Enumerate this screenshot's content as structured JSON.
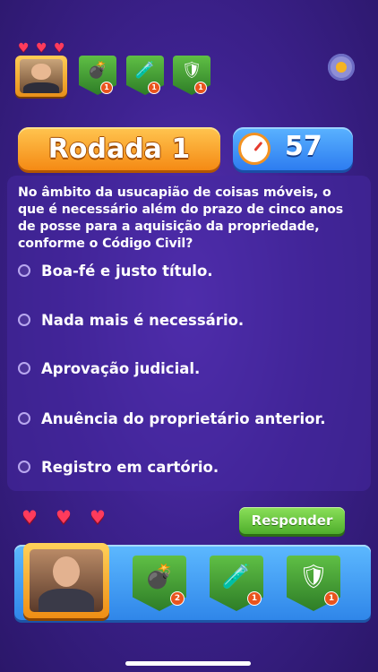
{
  "opponent": {
    "hearts": [
      "♥",
      "♥",
      "♥"
    ],
    "powerups": [
      {
        "icon": "bomb-icon",
        "glyph": "💣",
        "count": "1"
      },
      {
        "icon": "potion-icon",
        "glyph": "🧪",
        "count": "1"
      },
      {
        "icon": "shield-icon",
        "glyph": "🛡",
        "count": "1"
      }
    ]
  },
  "settings_icon": "gear-icon",
  "round": {
    "label": "Rodada 1"
  },
  "timer": {
    "icon": "stopwatch-icon",
    "value": "57"
  },
  "question": {
    "text": "No âmbito da usucapião de coisas móveis, o que é necessário além do prazo de cinco anos de posse para a aquisição da propriedade, conforme o Código Civil?",
    "options": [
      "Boa-fé e justo título.",
      "Nada mais é necessário.",
      "Aprovação judicial.",
      "Anuência do proprietário anterior.",
      "Registro em cartório."
    ]
  },
  "player": {
    "hearts": [
      "♥",
      "♥",
      "♥"
    ],
    "answer_label": "Responder",
    "powerups": [
      {
        "icon": "bomb-icon",
        "glyph": "💣",
        "count": "2"
      },
      {
        "icon": "potion-icon",
        "glyph": "🧪",
        "count": "1"
      },
      {
        "icon": "shield-icon",
        "glyph": "🛡",
        "count": "1"
      }
    ]
  },
  "colors": {
    "accent": "#f58a14",
    "timer": "#2d7cf0",
    "answer": "#4fae2c",
    "background": "#3e2290"
  }
}
